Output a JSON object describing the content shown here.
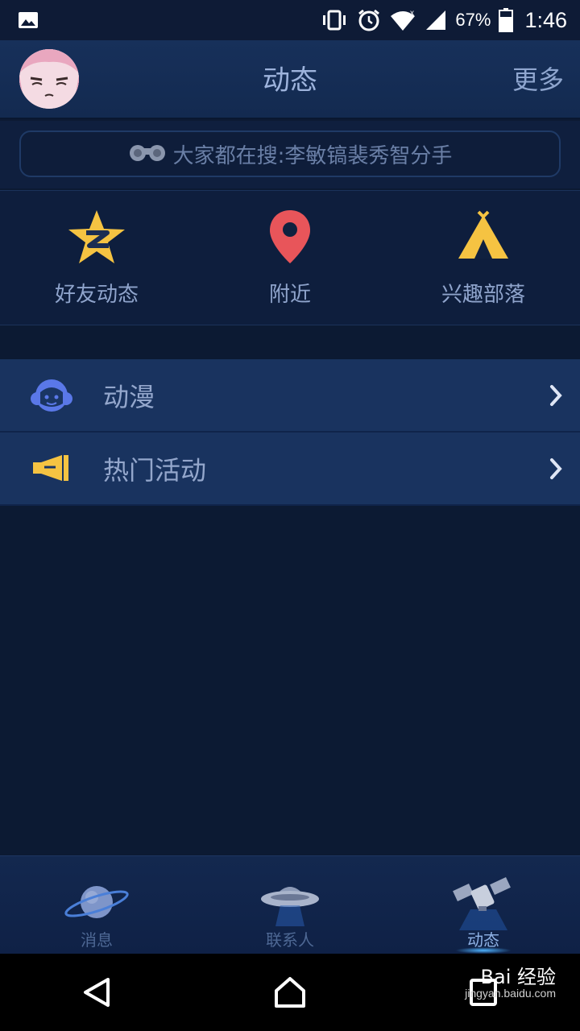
{
  "status_bar": {
    "battery": "67%",
    "time": "1:46"
  },
  "header": {
    "title": "动态",
    "more": "更多"
  },
  "search": {
    "text": "大家都在搜:李敏镐裴秀智分手"
  },
  "quick_links": [
    {
      "label": "好友动态",
      "icon": "qzone-star-icon"
    },
    {
      "label": "附近",
      "icon": "location-pin-icon"
    },
    {
      "label": "兴趣部落",
      "icon": "tent-icon"
    }
  ],
  "list": [
    {
      "label": "动漫",
      "icon": "anime-face-icon"
    },
    {
      "label": "热门活动",
      "icon": "megaphone-icon"
    }
  ],
  "tabs": [
    {
      "label": "消息",
      "icon": "planet-icon",
      "active": false
    },
    {
      "label": "联系人",
      "icon": "ufo-icon",
      "active": false
    },
    {
      "label": "动态",
      "icon": "satellite-icon",
      "active": true
    }
  ],
  "watermark": {
    "brand": "Bai 经验",
    "url": "jingyan.baidu.com"
  },
  "colors": {
    "background": "#0c1a33",
    "list_item": "#19335f",
    "star_yellow": "#f5c342",
    "pin_red": "#e8555a",
    "anime_blue": "#5a78e8"
  }
}
